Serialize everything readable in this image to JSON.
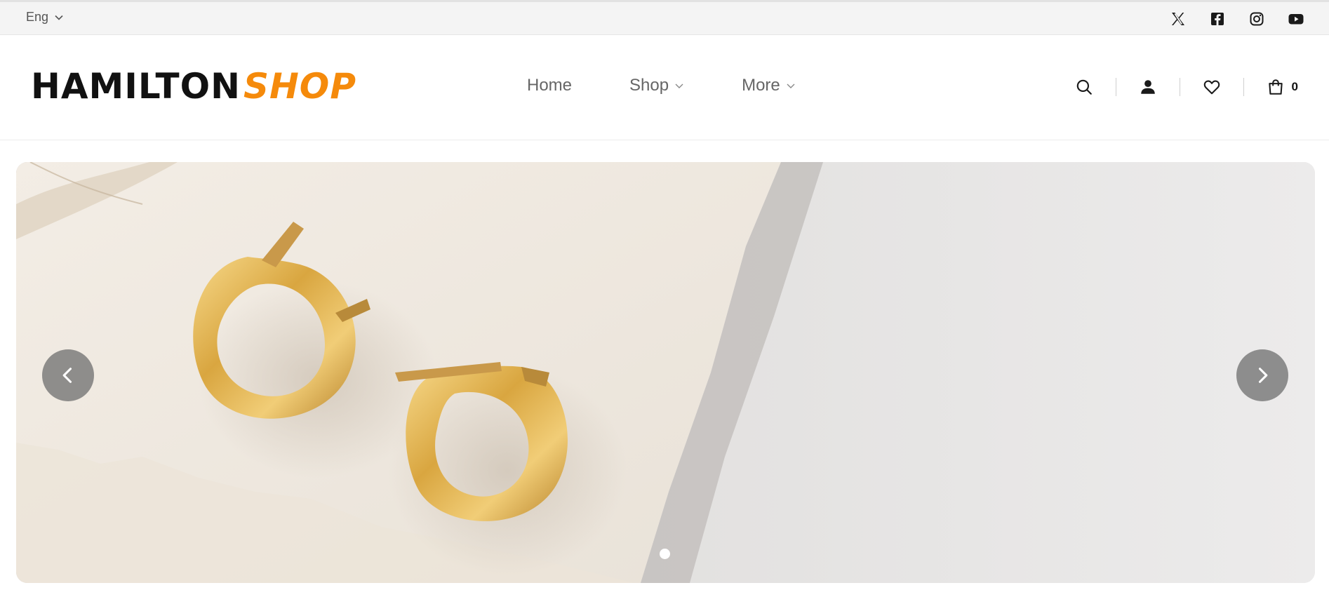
{
  "topbar": {
    "language": "Eng",
    "socials": [
      {
        "icon": "x-twitter-icon"
      },
      {
        "icon": "facebook-icon"
      },
      {
        "icon": "instagram-icon"
      },
      {
        "icon": "youtube-icon"
      }
    ]
  },
  "header": {
    "logo": {
      "part1": "HAMILTON",
      "part2": "SHOP"
    },
    "nav": [
      {
        "label": "Home",
        "dropdown": false
      },
      {
        "label": "Shop",
        "dropdown": true
      },
      {
        "label": "More",
        "dropdown": true
      }
    ],
    "cart_count": "0"
  },
  "hero": {
    "slide_count": 1,
    "active_slide": 1
  },
  "colors": {
    "brand_orange": "#f58a0b",
    "topbar_bg": "#f4f4f4",
    "arrow_bg": "#6e6e6e"
  }
}
